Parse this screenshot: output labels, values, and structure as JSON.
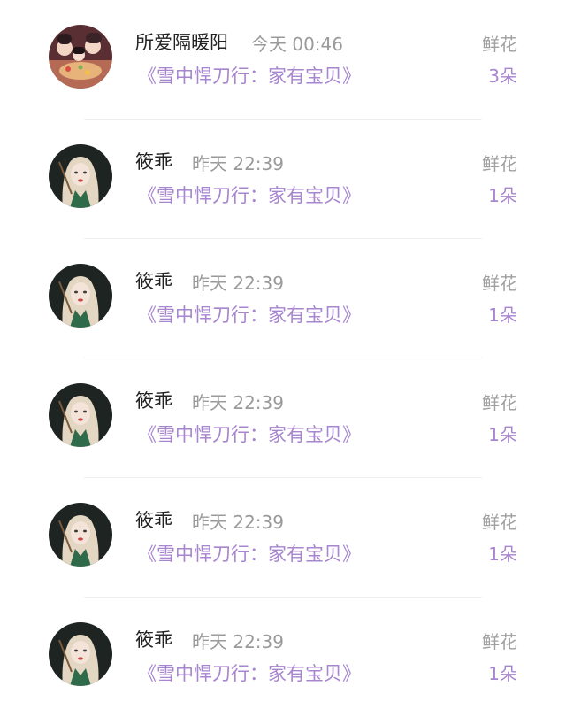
{
  "rows": [
    {
      "name": "所爱隔暖阳",
      "time": "今天 00:46",
      "book": "《雪中悍刀行：家有宝贝》",
      "gift_type": "鲜花",
      "gift_count": "3朵",
      "avatar": "group-illustration-avatar"
    },
    {
      "name": "筱乖",
      "time": "昨天 22:39",
      "book": "《雪中悍刀行：家有宝贝》",
      "gift_type": "鲜花",
      "gift_count": "1朵",
      "avatar": "blonde-girl-avatar"
    },
    {
      "name": "筱乖",
      "time": "昨天 22:39",
      "book": "《雪中悍刀行：家有宝贝》",
      "gift_type": "鲜花",
      "gift_count": "1朵",
      "avatar": "blonde-girl-avatar"
    },
    {
      "name": "筱乖",
      "time": "昨天 22:39",
      "book": "《雪中悍刀行：家有宝贝》",
      "gift_type": "鲜花",
      "gift_count": "1朵",
      "avatar": "blonde-girl-avatar"
    },
    {
      "name": "筱乖",
      "time": "昨天 22:39",
      "book": "《雪中悍刀行：家有宝贝》",
      "gift_type": "鲜花",
      "gift_count": "1朵",
      "avatar": "blonde-girl-avatar"
    },
    {
      "name": "筱乖",
      "time": "昨天 22:39",
      "book": "《雪中悍刀行：家有宝贝》",
      "gift_type": "鲜花",
      "gift_count": "1朵",
      "avatar": "blonde-girl-avatar"
    }
  ],
  "colors": {
    "accent": "#a785cf",
    "name_text": "#222222",
    "muted_text": "#9a9a9a"
  }
}
